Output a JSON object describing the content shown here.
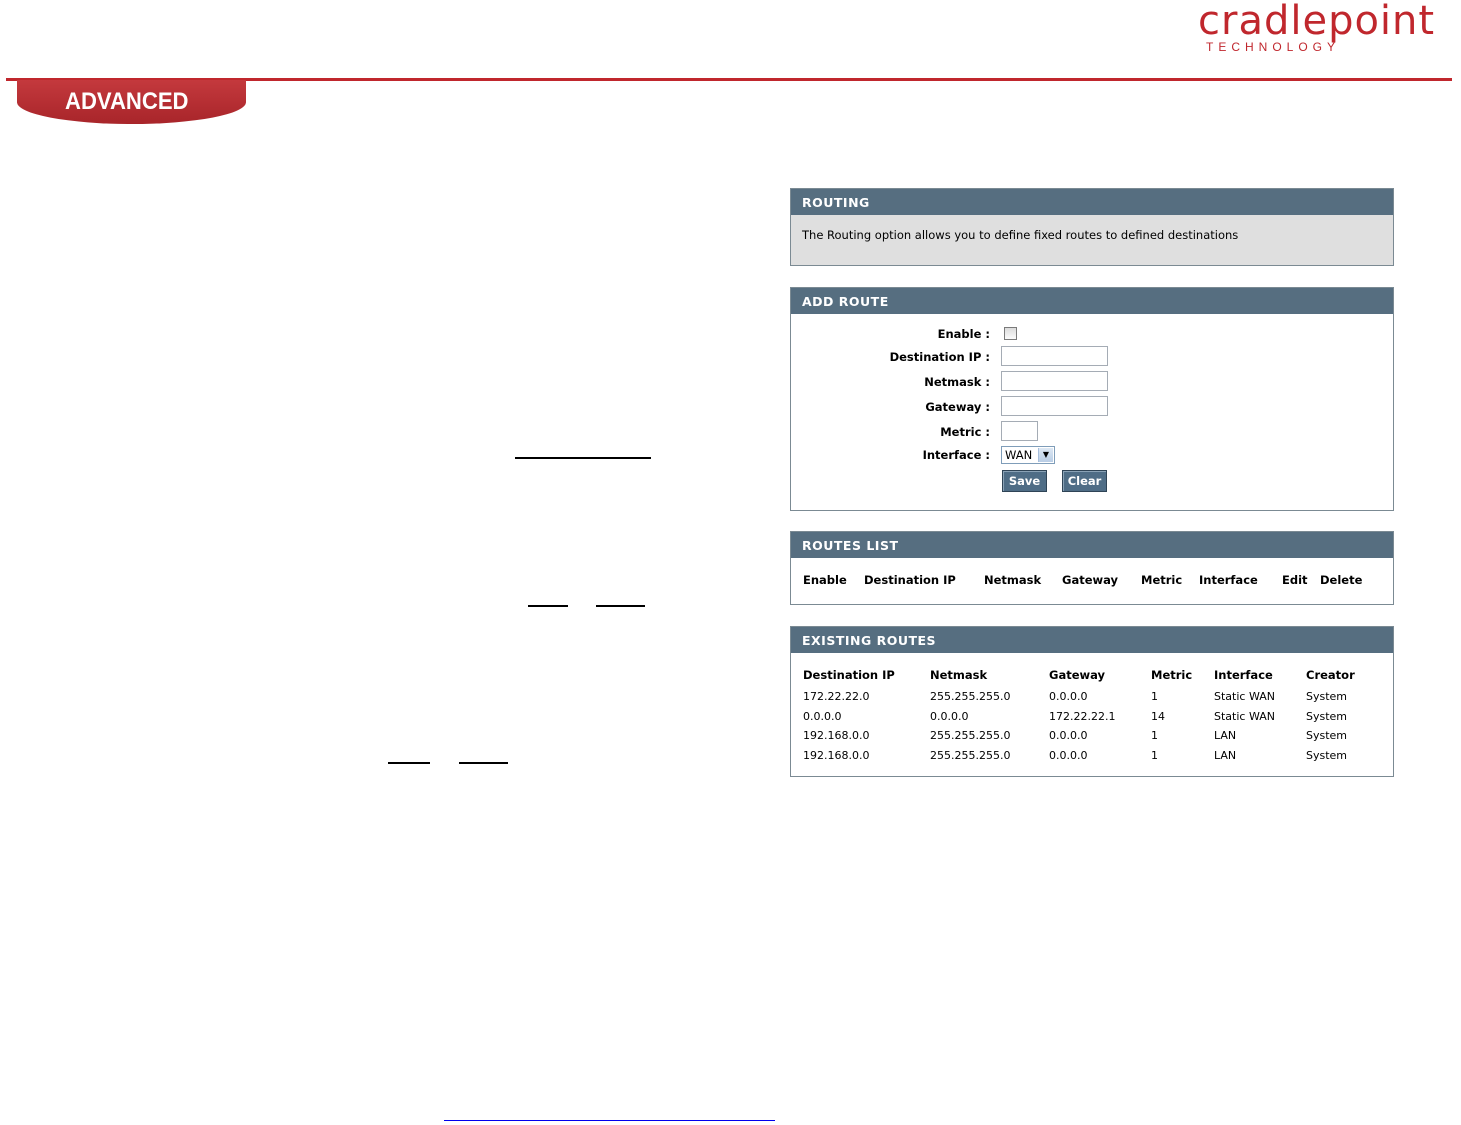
{
  "header": {
    "logo_main": "cradlepoint",
    "logo_sub": "TECHNOLOGY",
    "section_tab": "ADVANCED"
  },
  "routing": {
    "title": "ROUTING",
    "description": "The Routing option allows you to define fixed routes to defined destinations"
  },
  "add_route": {
    "title": "ADD ROUTE",
    "enable_label": "Enable :",
    "dest_ip_label": "Destination IP :",
    "netmask_label": "Netmask :",
    "gateway_label": "Gateway :",
    "metric_label": "Metric :",
    "interface_label": "Interface :",
    "interface_value": "WAN",
    "save_label": "Save",
    "clear_label": "Clear"
  },
  "routes_list": {
    "title": "ROUTES LIST",
    "columns": [
      "Enable",
      "Destination IP",
      "Netmask",
      "Gateway",
      "Metric",
      "Interface",
      "Edit",
      "Delete"
    ]
  },
  "existing_routes": {
    "title": "EXISTING ROUTES",
    "columns": [
      "Destination IP",
      "Netmask",
      "Gateway",
      "Metric",
      "Interface",
      "Creator"
    ],
    "rows": [
      [
        "172.22.22.0",
        "255.255.255.0",
        "0.0.0.0",
        "1",
        "Static WAN",
        "System"
      ],
      [
        "0.0.0.0",
        "0.0.0.0",
        "172.22.22.1",
        "14",
        "Static WAN",
        "System"
      ],
      [
        "192.168.0.0",
        "255.255.255.0",
        "0.0.0.0",
        "1",
        "LAN",
        "System"
      ],
      [
        "192.168.0.0",
        "255.255.255.0",
        "0.0.0.0",
        "1",
        "LAN",
        "System"
      ]
    ]
  }
}
